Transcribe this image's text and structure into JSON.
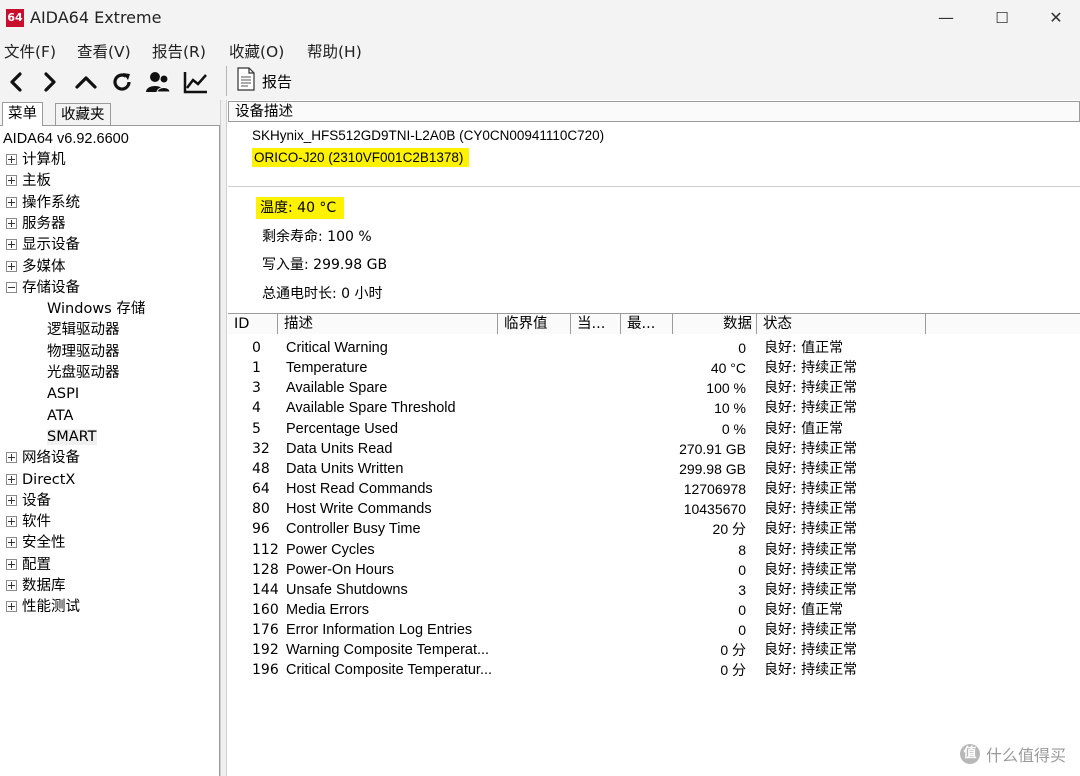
{
  "window": {
    "app_icon_text": "64",
    "title": "AIDA64 Extreme",
    "min_glyph": "—",
    "max_glyph": "☐",
    "close_glyph": "✕"
  },
  "menu": [
    "文件(F)",
    "查看(V)",
    "报告(R)",
    "收藏(O)",
    "帮助(H)"
  ],
  "toolbar": {
    "buttons": [
      "back-icon",
      "forward-icon",
      "up-icon",
      "refresh-icon",
      "user-icon",
      "chart-icon"
    ],
    "report_label": "报告"
  },
  "left_tabs": {
    "menu": "菜单",
    "favorites": "收藏夹"
  },
  "tree": {
    "version": "AIDA64 v6.92.6600",
    "items": [
      {
        "label": "计算机",
        "exp": "plus"
      },
      {
        "label": "主板",
        "exp": "plus"
      },
      {
        "label": "操作系统",
        "exp": "plus"
      },
      {
        "label": "服务器",
        "exp": "plus"
      },
      {
        "label": "显示设备",
        "exp": "plus"
      },
      {
        "label": "多媒体",
        "exp": "plus"
      },
      {
        "label": "存储设备",
        "exp": "minus"
      },
      {
        "label": "Windows 存储",
        "child": true
      },
      {
        "label": "逻辑驱动器",
        "child": true
      },
      {
        "label": "物理驱动器",
        "child": true
      },
      {
        "label": "光盘驱动器",
        "child": true
      },
      {
        "label": "ASPI",
        "child": true
      },
      {
        "label": "ATA",
        "child": true
      },
      {
        "label": "SMART",
        "child": true,
        "selected": true
      },
      {
        "label": "网络设备",
        "exp": "plus"
      },
      {
        "label": "DirectX",
        "exp": "plus"
      },
      {
        "label": "设备",
        "exp": "plus"
      },
      {
        "label": "软件",
        "exp": "plus"
      },
      {
        "label": "安全性",
        "exp": "plus"
      },
      {
        "label": "配置",
        "exp": "plus"
      },
      {
        "label": "数据库",
        "exp": "plus"
      },
      {
        "label": "性能测试",
        "exp": "plus"
      }
    ]
  },
  "device_header": "设备描述",
  "devices": [
    "SKHynix_HFS512GD9TNI-L2A0B (CY0CN00941110C720)",
    "ORICO-J20 (2310VF001C2B1378)"
  ],
  "info": {
    "temperature": "温度: 40 °C",
    "life": "剩余寿命: 100 %",
    "written": "写入量: 299.98 GB",
    "power_on": "总通电时长: 0 小时"
  },
  "columns": [
    "ID",
    "描述",
    "临界值",
    "当...",
    "最...",
    "数据",
    "状态"
  ],
  "rows": [
    {
      "id": "0",
      "desc": "Critical Warning",
      "data": "0",
      "status": "良好: 值正常"
    },
    {
      "id": "1",
      "desc": "Temperature",
      "data": "40 °C",
      "status": "良好: 持续正常"
    },
    {
      "id": "3",
      "desc": "Available Spare",
      "data": "100 %",
      "status": "良好: 持续正常"
    },
    {
      "id": "4",
      "desc": "Available Spare Threshold",
      "data": "10 %",
      "status": "良好: 持续正常"
    },
    {
      "id": "5",
      "desc": "Percentage Used",
      "data": "0 %",
      "status": "良好: 值正常"
    },
    {
      "id": "32",
      "desc": "Data Units Read",
      "data": "270.91 GB",
      "status": "良好: 持续正常"
    },
    {
      "id": "48",
      "desc": "Data Units Written",
      "data": "299.98 GB",
      "status": "良好: 持续正常"
    },
    {
      "id": "64",
      "desc": "Host Read Commands",
      "data": "12706978",
      "status": "良好: 持续正常"
    },
    {
      "id": "80",
      "desc": "Host Write Commands",
      "data": "10435670",
      "status": "良好: 持续正常"
    },
    {
      "id": "96",
      "desc": "Controller Busy Time",
      "data": "20 分",
      "status": "良好: 持续正常"
    },
    {
      "id": "112",
      "desc": "Power Cycles",
      "data": "8",
      "status": "良好: 持续正常"
    },
    {
      "id": "128",
      "desc": "Power-On Hours",
      "data": "0",
      "status": "良好: 持续正常"
    },
    {
      "id": "144",
      "desc": "Unsafe Shutdowns",
      "data": "3",
      "status": "良好: 持续正常"
    },
    {
      "id": "160",
      "desc": "Media Errors",
      "data": "0",
      "status": "良好: 值正常"
    },
    {
      "id": "176",
      "desc": "Error Information Log Entries",
      "data": "0",
      "status": "良好: 持续正常"
    },
    {
      "id": "192",
      "desc": "Warning Composite Temperat...",
      "data": "0 分",
      "status": "良好: 持续正常"
    },
    {
      "id": "196",
      "desc": "Critical Composite Temperatur...",
      "data": "0 分",
      "status": "良好: 持续正常"
    }
  ],
  "watermark": {
    "glyph": "值",
    "text": "什么值得买"
  },
  "colors": {
    "highlight": "#fff200",
    "brand": "#c8102e"
  }
}
